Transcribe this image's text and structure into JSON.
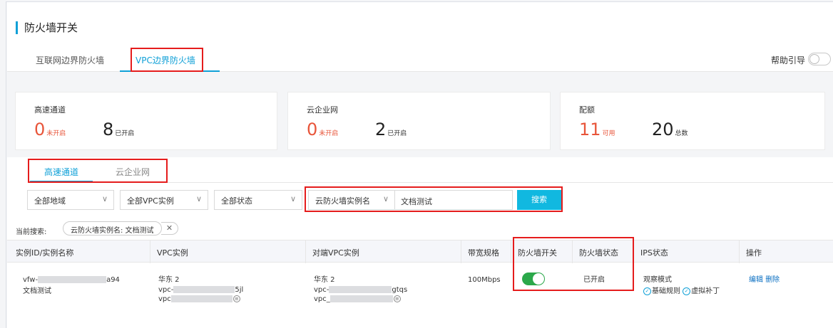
{
  "page": {
    "title": "防火墙开关"
  },
  "top_tabs": [
    {
      "label": "互联网边界防火墙",
      "active": false
    },
    {
      "label": "VPC边界防火墙",
      "active": true
    }
  ],
  "help": {
    "label": "帮助引导",
    "toggle_on": false
  },
  "cards": [
    {
      "label": "高速通道",
      "stats": [
        {
          "value": "0",
          "unit": "未开启",
          "color": "#e8553a"
        },
        {
          "value": "8",
          "unit": "已开启",
          "color": "#222222"
        }
      ]
    },
    {
      "label": "云企业网",
      "stats": [
        {
          "value": "0",
          "unit": "未开启",
          "color": "#e8553a"
        },
        {
          "value": "2",
          "unit": "已开启",
          "color": "#222222"
        }
      ]
    },
    {
      "label": "配额",
      "stats": [
        {
          "value": "11",
          "unit": "可用",
          "color": "#e8553a"
        },
        {
          "value": "20",
          "unit": "总数",
          "color": "#222222"
        }
      ]
    }
  ],
  "sub_tabs": [
    {
      "label": "高速通道",
      "active": true
    },
    {
      "label": "云企业网",
      "active": false
    }
  ],
  "filters": {
    "region": "全部地域",
    "vpc_instance": "全部VPC实例",
    "status": "全部状态",
    "search_field": "云防火墙实例名",
    "search_value": "文档测试",
    "search_button": "搜索"
  },
  "current_search": {
    "label": "当前搜索:",
    "chip": "云防火墙实例名: 文档测试",
    "clear_icon": "close-icon"
  },
  "table": {
    "columns": [
      "实例ID/实例名称",
      "VPC实例",
      "对端VPC实例",
      "带宽规格",
      "防火墙开关",
      "防火墙状态",
      "IPS状态",
      "操作"
    ],
    "rows": [
      {
        "instance_id_prefix": "vfw-",
        "instance_id_suffix": "a94",
        "instance_name": "文档测试",
        "vpc_region": "华东 2",
        "vpc_id_prefix": "vpc-",
        "vpc_id_suffix": "5jl",
        "vpc_id2_prefix": "vpc",
        "peer_region": "华东 2",
        "peer_id_prefix": "vpc-",
        "peer_id_suffix": "gtqs",
        "peer_id2_prefix": "vpc_",
        "bandwidth": "100Mbps",
        "firewall_switch_on": true,
        "firewall_status": "已开启",
        "ips_mode": "观察模式",
        "ips_basic": "基础规则",
        "ips_virtual": "虚拟补丁",
        "action_edit": "编辑",
        "action_delete": "删除"
      }
    ]
  },
  "colors": {
    "accent": "#0fa0d7",
    "highlight_box": "#e51c1c",
    "switch_on": "#2ba84a",
    "search_button": "#11b8e0",
    "link": "#0a6fc2"
  }
}
